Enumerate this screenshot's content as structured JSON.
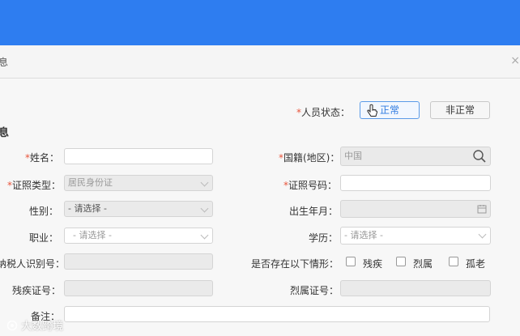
{
  "dialog": {
    "title": "息",
    "close_icon": "×"
  },
  "status": {
    "label": "人员状态：",
    "options": [
      "正常",
      "非正常"
    ],
    "selected": "正常"
  },
  "section_title": "息",
  "fields": {
    "name": {
      "label": "姓名：",
      "value": ""
    },
    "nationality": {
      "label": "国籍(地区)：",
      "value": "中国"
    },
    "id_type": {
      "label": "证照类型：",
      "value": "居民身份证"
    },
    "id_number": {
      "label": "证照号码：",
      "value": ""
    },
    "gender": {
      "label": "性别：",
      "value": "- 请选择 -"
    },
    "birth": {
      "label": "出生年月：",
      "value": ""
    },
    "occupation": {
      "label": "职业：",
      "value": "- 请选择 -"
    },
    "education": {
      "label": "学历：",
      "value": "- 请选择 -"
    },
    "taxpayer_id": {
      "label": "纳税人识别号：",
      "value": ""
    },
    "conditions": {
      "label": "是否存在以下情形：",
      "options": [
        "残疾",
        "烈属",
        "孤老"
      ]
    },
    "disability_cert": {
      "label": "残疾证号：",
      "value": ""
    },
    "martyr_cert": {
      "label": "烈属证号：",
      "value": ""
    },
    "remarks": {
      "label": "备注：",
      "value": ""
    }
  },
  "watermark": "大数跨境",
  "colors": {
    "topbar": "#2e7df0",
    "required": "#e8553b",
    "active_button": "#2f7be0"
  }
}
